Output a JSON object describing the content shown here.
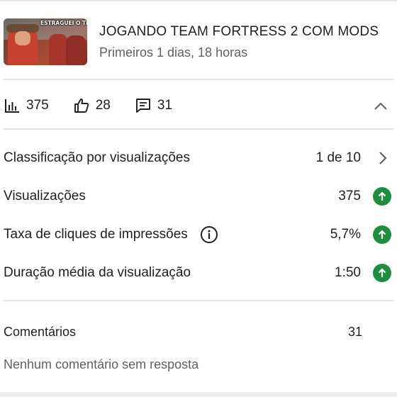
{
  "video": {
    "thumbnail_caption": "ESTRAGUEI O TF?",
    "title": "JOGANDO TEAM FORTRESS 2 COM MODS",
    "subtitle": "Primeiros 1 dias, 18 horas"
  },
  "stats": {
    "views": "375",
    "likes": "28",
    "comments": "31",
    "icons": [
      "bar-chart-icon",
      "thumbs-up-icon",
      "comment-icon",
      "chevron-up-icon"
    ]
  },
  "metrics": [
    {
      "label": "Classificação por visualizações",
      "value": "1 de 10",
      "indicator": "chevron-right-icon"
    },
    {
      "label": "Visualizações",
      "value": "375",
      "indicator": "arrow-up-icon"
    },
    {
      "label": "Taxa de cliques de impressões",
      "value": "5,7%",
      "indicator": "arrow-up-icon",
      "has_info": true
    },
    {
      "label": "Duração média da visualização",
      "value": "1:50",
      "indicator": "arrow-up-icon"
    }
  ],
  "comments_section": {
    "label": "Comentários",
    "count": "31",
    "status": "Nenhum comentário sem resposta"
  },
  "colors": {
    "positive": "#1e8e3e",
    "text_primary": "#1f1f1f",
    "text_secondary": "#606060"
  }
}
